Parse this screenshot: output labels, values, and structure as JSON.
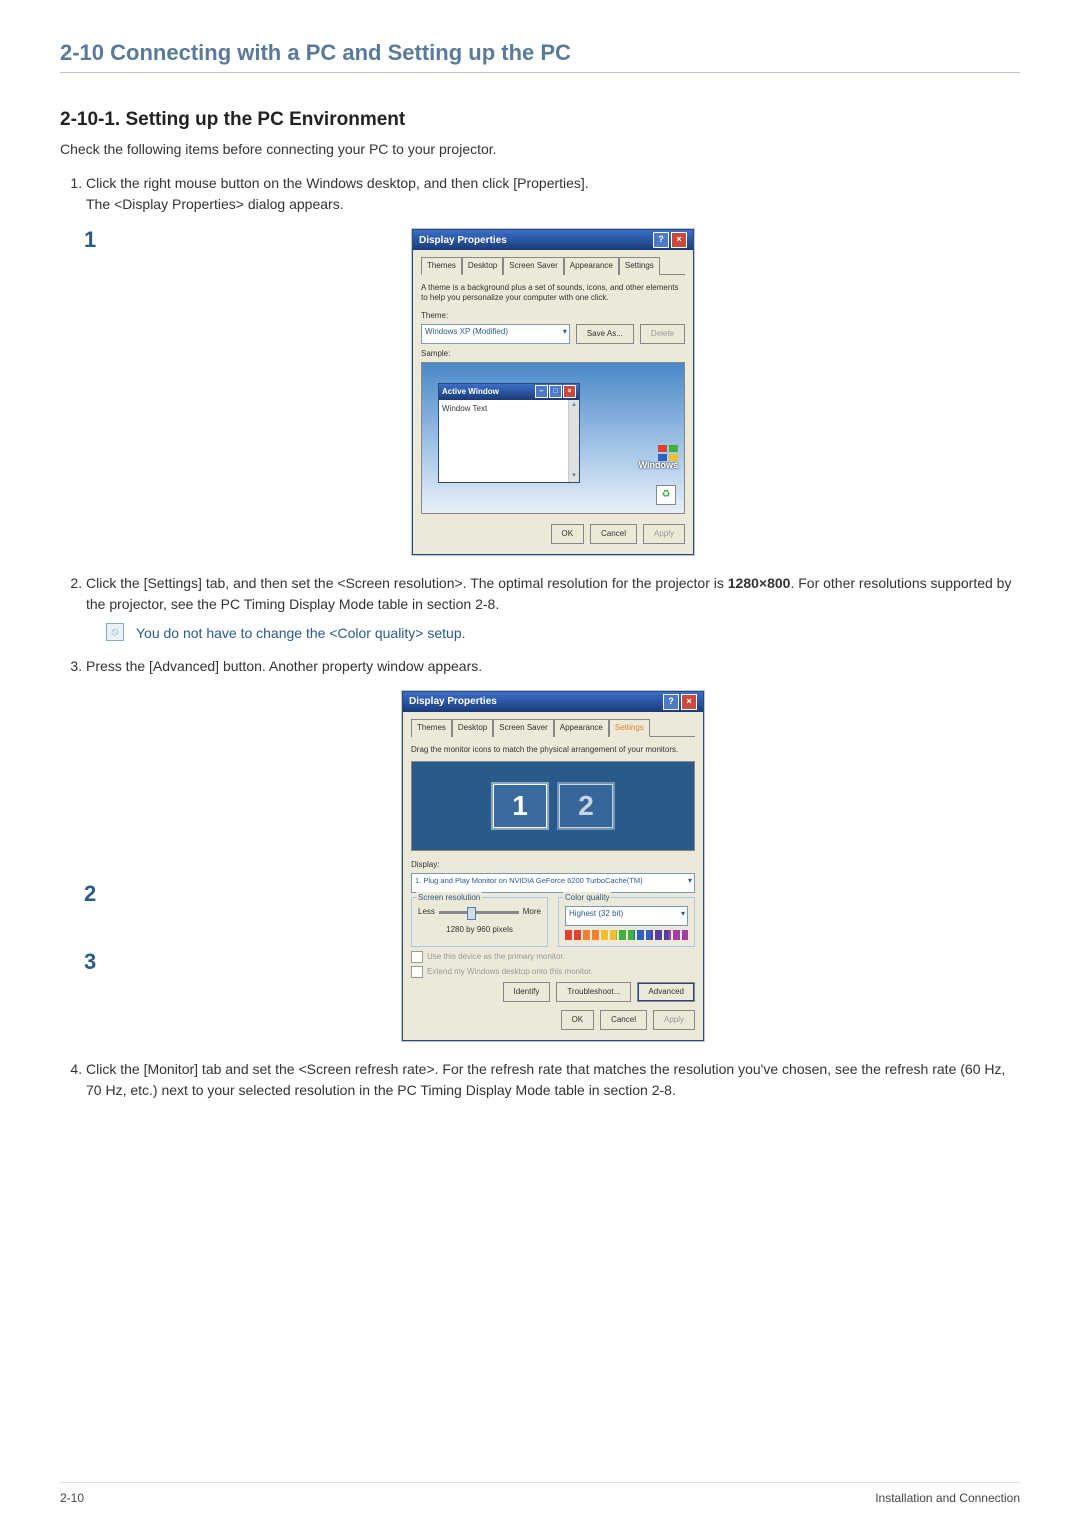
{
  "headings": {
    "h1": "2-10  Connecting with a PC and Setting up the PC",
    "h2": "2-10-1. Setting up the PC Environment"
  },
  "intro": "Check the following items before connecting your PC to your projector.",
  "steps": {
    "s1a": "Click the right mouse button on the Windows desktop, and then click [Properties].",
    "s1b": "The <Display Properties> dialog appears.",
    "s2a": "Click the [Settings] tab, and then set the <Screen resolution>. The optimal resolution for the projector is ",
    "s2b": "1280×800",
    "s2c": ". For other resolutions supported by the projector, see the PC Timing Display Mode table in section 2-8.",
    "note": "You do not have to change the <Color quality> setup.",
    "s3": "Press the [Advanced] button. Another property window appears.",
    "s4": "Click the [Monitor] tab and set the <Screen refresh rate>. For the refresh rate that matches the resolution you've chosen, see the refresh rate (60 Hz, 70 Hz, etc.) next to your selected resolution in the PC Timing Display Mode table in section 2-8."
  },
  "dlg1": {
    "title": "Display Properties",
    "tabs": [
      "Themes",
      "Desktop",
      "Screen Saver",
      "Appearance",
      "Settings"
    ],
    "activeTab": 0,
    "desc": "A theme is a background plus a set of sounds, icons, and other elements to help you personalize your computer with one click.",
    "themeLabel": "Theme:",
    "themeValue": "Windows XP (Modified)",
    "saveAs": "Save As...",
    "delete": "Delete",
    "sampleLabel": "Sample:",
    "innerTitle": "Active Window",
    "innerText": "Window Text",
    "logo": "Windows",
    "ok": "OK",
    "cancel": "Cancel",
    "apply": "Apply"
  },
  "dlg2": {
    "title": "Display Properties",
    "tabs": [
      "Themes",
      "Desktop",
      "Screen Saver",
      "Appearance",
      "Settings"
    ],
    "activeTab": 4,
    "desc": "Drag the monitor icons to match the physical arrangement of your monitors.",
    "displayLabel": "Display:",
    "displayValue": "1. Plug and Play Monitor on NVIDIA GeForce 6200 TurboCache(TM)",
    "resTitle": "Screen resolution",
    "less": "Less",
    "more": "More",
    "resVal": "1280 by 960   pixels",
    "cqTitle": "Color quality",
    "cqValue": "Highest (32 bit)",
    "chk1": "Use this device as the primary monitor.",
    "chk2": "Extend my Windows desktop onto this monitor.",
    "identify": "Identify",
    "troubleshoot": "Troubleshoot...",
    "advanced": "Advanced",
    "ok": "OK",
    "cancel": "Cancel",
    "apply": "Apply"
  },
  "callouts": {
    "c1": "1",
    "c2": "2",
    "c3": "3"
  },
  "footer": {
    "left": "2-10",
    "right": "Installation and Connection"
  }
}
